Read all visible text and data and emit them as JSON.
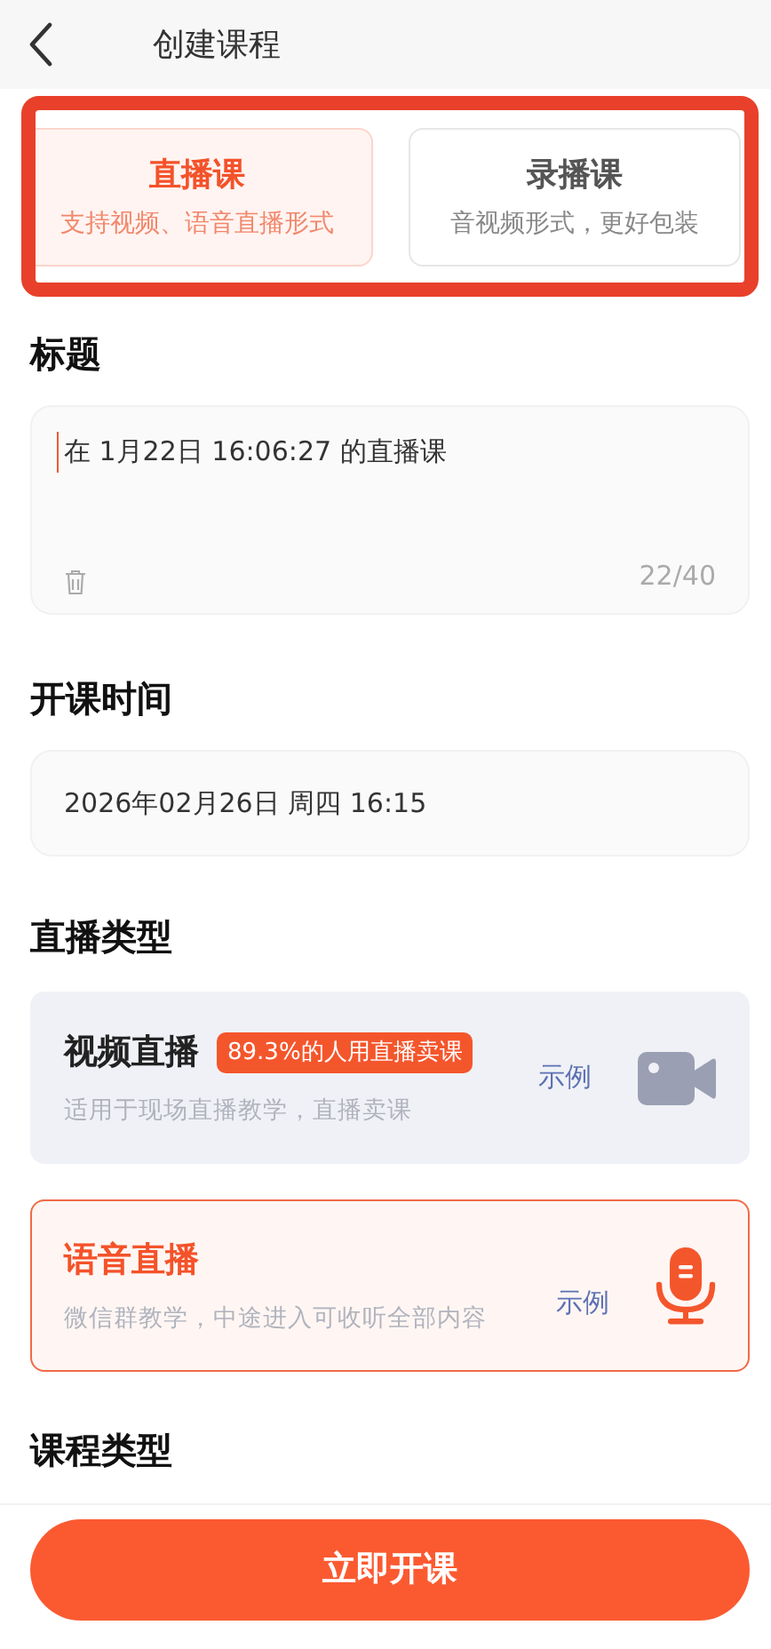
{
  "header": {
    "title": "创建课程"
  },
  "course_kinds": [
    {
      "label": "直播课",
      "description": "支持视频、语音直播形式",
      "selected": true
    },
    {
      "label": "录播课",
      "description": "音视频形式，更好包装",
      "selected": false
    }
  ],
  "title_section": {
    "heading": "标题",
    "value": "在 1月22日 16:06:27 的直播课",
    "counter": "22/40"
  },
  "time_section": {
    "heading": "开课时间",
    "value": "2026年02月26日 周四 16:15"
  },
  "live_type_section": {
    "heading": "直播类型",
    "options": [
      {
        "kind": "video",
        "label": "视频直播",
        "badge": "89.3%的人用直播卖课",
        "description": "适用于现场直播教学，直播卖课",
        "example": "示例",
        "selected": false
      },
      {
        "kind": "audio",
        "label": "语音直播",
        "description": "微信群教学，中途进入可收听全部内容",
        "example": "示例",
        "selected": true
      }
    ]
  },
  "course_type_section": {
    "heading": "课程类型"
  },
  "submit_button": "立即开课"
}
